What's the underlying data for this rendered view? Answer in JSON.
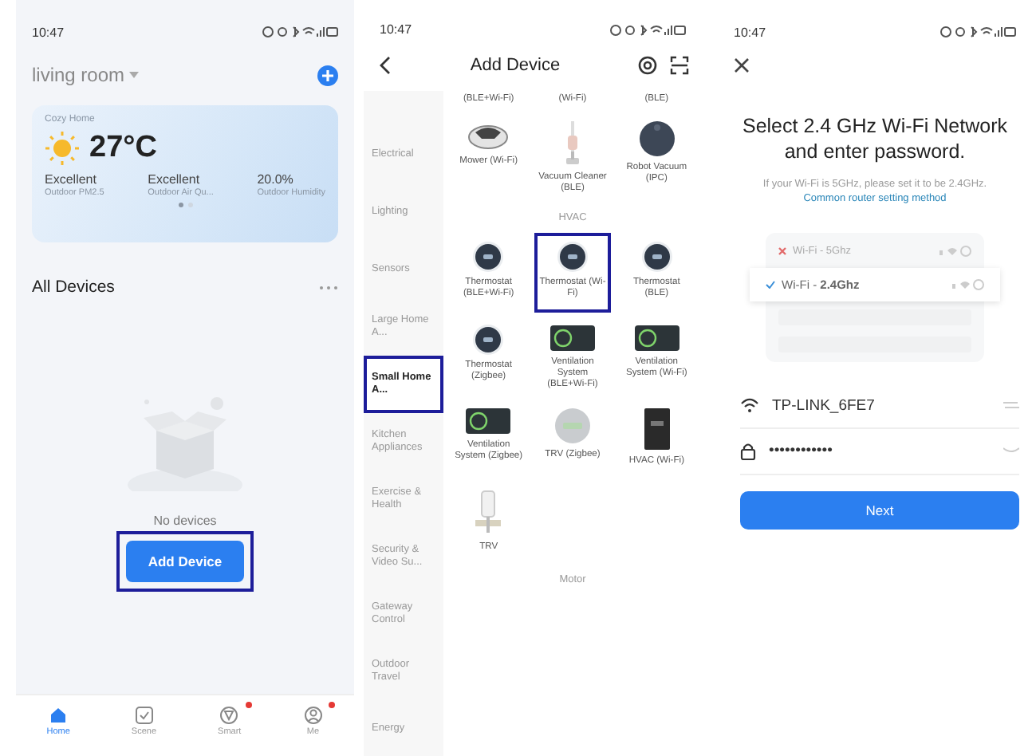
{
  "home": {
    "time": "10:47",
    "room": "living room",
    "weather": {
      "title": "Cozy Home",
      "temperature": "27°C",
      "stats": [
        {
          "value": "Excellent",
          "label": "Outdoor PM2.5"
        },
        {
          "value": "Excellent",
          "label": "Outdoor Air Qu..."
        },
        {
          "value": "20.0%",
          "label": "Outdoor Humidity"
        }
      ],
      "pages": [
        {
          "selected": true
        },
        {
          "selected": false
        }
      ]
    },
    "section_title": "All Devices",
    "empty_text": "No devices",
    "add_button": {
      "label": "Add Device",
      "highlighted": true
    },
    "tabs": [
      {
        "label": "Home",
        "selected": true,
        "badge": false
      },
      {
        "label": "Scene",
        "selected": false,
        "badge": false
      },
      {
        "label": "Smart",
        "selected": false,
        "badge": true
      },
      {
        "label": "Me",
        "selected": false,
        "badge": true
      }
    ]
  },
  "add_device": {
    "time": "10:47",
    "title": "Add Device",
    "categories": [
      {
        "label": "Electrical",
        "selected": false,
        "highlighted": false
      },
      {
        "label": "Lighting",
        "selected": false,
        "highlighted": false
      },
      {
        "label": "Sensors",
        "selected": false,
        "highlighted": false
      },
      {
        "label": "Large Home A...",
        "selected": false,
        "highlighted": false
      },
      {
        "label": "Small Home A...",
        "selected": true,
        "highlighted": true
      },
      {
        "label": "Kitchen Appliances",
        "selected": false,
        "highlighted": false
      },
      {
        "label": "Exercise & Health",
        "selected": false,
        "highlighted": false
      },
      {
        "label": "Security & Video Su...",
        "selected": false,
        "highlighted": false
      },
      {
        "label": "Gateway Control",
        "selected": false,
        "highlighted": false
      },
      {
        "label": "Outdoor Travel",
        "selected": false,
        "highlighted": false
      },
      {
        "label": "Energy",
        "selected": false,
        "highlighted": false
      }
    ],
    "sections": [
      {
        "items": [
          {
            "label": "(BLE+Wi-Fi)",
            "kind": "none",
            "highlighted": false
          },
          {
            "label": "(Wi-Fi)",
            "kind": "none",
            "highlighted": false
          },
          {
            "label": "(BLE)",
            "kind": "none",
            "highlighted": false
          },
          {
            "label": "Mower (Wi-Fi)",
            "kind": "mower",
            "highlighted": false
          },
          {
            "label": "Vacuum Cleaner (BLE)",
            "kind": "stick",
            "highlighted": false
          },
          {
            "label": "Robot Vacuum (IPC)",
            "kind": "robot",
            "highlighted": false
          }
        ]
      },
      {
        "title": "HVAC",
        "items": [
          {
            "label": "Thermostat (BLE+Wi-Fi)",
            "kind": "thermostat",
            "highlighted": false
          },
          {
            "label": "Thermostat (Wi-Fi)",
            "kind": "thermostat",
            "highlighted": true
          },
          {
            "label": "Thermostat (BLE)",
            "kind": "thermostat",
            "highlighted": false
          },
          {
            "label": "Thermostat (Zigbee)",
            "kind": "thermostat",
            "highlighted": false
          },
          {
            "label": "Ventilation System (BLE+Wi-Fi)",
            "kind": "ventilation",
            "highlighted": false
          },
          {
            "label": "Ventilation System (Wi-Fi)",
            "kind": "ventilation",
            "highlighted": false
          },
          {
            "label": "Ventilation System (Zigbee)",
            "kind": "ventilation",
            "highlighted": false
          },
          {
            "label": "TRV (Zigbee)",
            "kind": "trv",
            "highlighted": false
          },
          {
            "label": "HVAC (Wi-Fi)",
            "kind": "panel",
            "highlighted": false
          },
          {
            "label": "TRV",
            "kind": "valve",
            "highlighted": false
          }
        ]
      },
      {
        "title": "Motor"
      }
    ]
  },
  "wifi_setup": {
    "time": "10:47",
    "heading": "Select 2.4 GHz Wi-Fi Network and enter password.",
    "hint": "If your Wi-Fi is 5GHz, please set it to be 2.4GHz.",
    "link": "Common router setting method",
    "networks": [
      {
        "label": "Wi-Fi - 5Ghz",
        "selected": false
      },
      {
        "label": "Wi-Fi - **2.4Ghz**",
        "selected": true
      }
    ],
    "ssid": "TP-LINK_6FE7",
    "password": "••••••••••••",
    "button": "Next"
  }
}
